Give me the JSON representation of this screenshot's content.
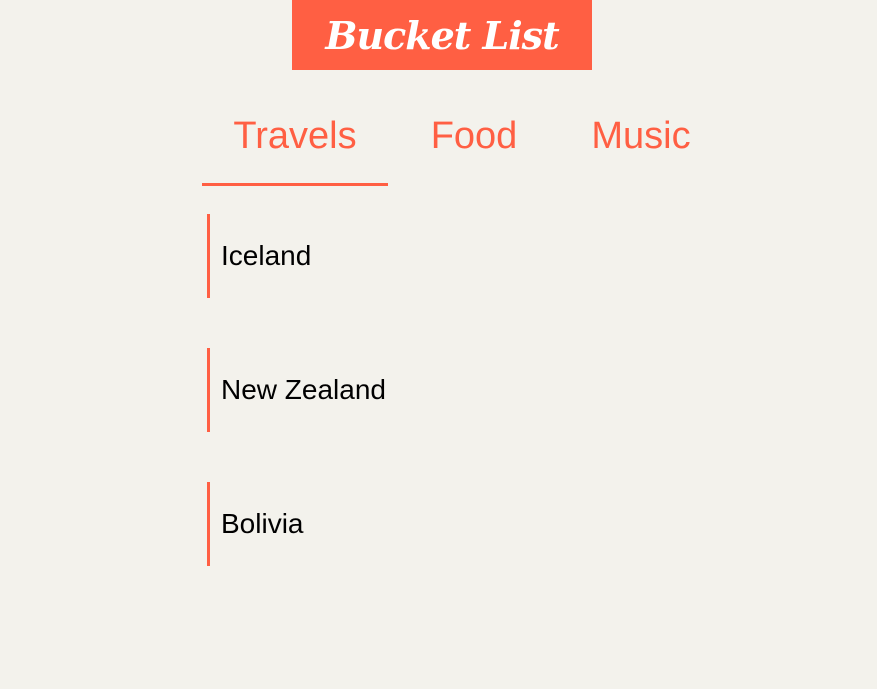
{
  "app": {
    "title": "Bucket List"
  },
  "tabs": [
    {
      "label": "Travels",
      "active": true
    },
    {
      "label": "Food",
      "active": false
    },
    {
      "label": "Music",
      "active": false
    }
  ],
  "list": {
    "items": [
      {
        "label": "Iceland"
      },
      {
        "label": "New Zealand"
      },
      {
        "label": "Bolivia"
      }
    ]
  },
  "colors": {
    "accent": "#ff5f43",
    "background": "#f3f2ec",
    "text": "#000000",
    "logo_text": "#ffffff"
  }
}
